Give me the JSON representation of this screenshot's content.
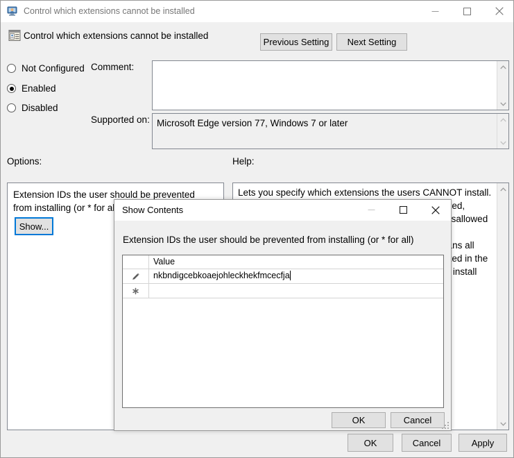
{
  "window": {
    "title": "Control which extensions cannot be installed",
    "icon": "computer-policy-icon",
    "minimize_label": "—",
    "maximize_label": "☐",
    "close_label": "✕"
  },
  "header": {
    "setting_title": "Control which extensions cannot be installed",
    "setting_icon": "policy-setting-icon",
    "previous_setting": "Previous Setting",
    "next_setting": "Next Setting"
  },
  "state": {
    "options": [
      {
        "label": "Not Configured",
        "selected": false
      },
      {
        "label": "Enabled",
        "selected": true
      },
      {
        "label": "Disabled",
        "selected": false
      }
    ]
  },
  "fields": {
    "comment_label": "Comment:",
    "comment_value": "",
    "supported_label": "Supported on:",
    "supported_value": "Microsoft Edge version 77, Windows 7 or later"
  },
  "sections": {
    "options_label": "Options:",
    "help_label": "Help:"
  },
  "options_panel": {
    "description": "Extension IDs the user should be prevented from installing (or * for all)",
    "show_button": "Show..."
  },
  "help_panel": {
    "text": "Lets you specify which extensions the users CANNOT install. Extensions already installed will be disabled if blocked, without a way for the user to enable them. After a disallowed extension is removed from the blocklist it will be automatically re-enabled. A blocklist value of '*' means all extensions are blocked unless they are explicitly listed in the allowlist. If this policy is not configured the user can install any extension in Microsoft Edge."
  },
  "dialog": {
    "title": "Show Contents",
    "caption": "Extension IDs the user should be prevented from installing (or * for all)",
    "grid": {
      "columns": [
        "",
        "Value"
      ],
      "rows": [
        {
          "indicator": "edit-pencil",
          "value": "nkbndigcebkoaejohleckhekfmcecfja",
          "editing": true
        },
        {
          "indicator": "new-row-asterisk",
          "value": "",
          "editing": false
        }
      ]
    },
    "ok_label": "OK",
    "cancel_label": "Cancel",
    "minimize_label": "—",
    "maximize_label": "☐",
    "close_label": "✕"
  },
  "footer": {
    "ok_label": "OK",
    "cancel_label": "Cancel",
    "apply_label": "Apply"
  },
  "colors": {
    "focus_blue": "#0078d7",
    "window_bg": "#f0f0f0",
    "button_face": "#e1e1e1",
    "border": "#828790",
    "title_text": "#767676"
  }
}
